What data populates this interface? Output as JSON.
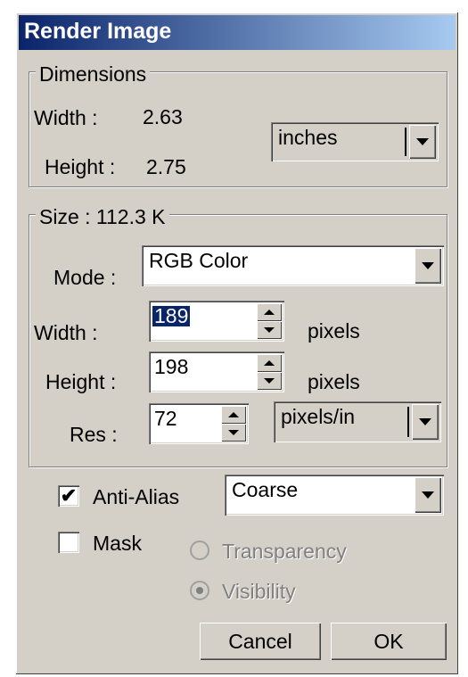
{
  "window": {
    "title": "Render Image"
  },
  "dimensions": {
    "legend": "Dimensions",
    "width_label": "Width :",
    "width_value": "2.63",
    "height_label": "Height :",
    "height_value": "2.75",
    "unit": "inches"
  },
  "size": {
    "legend": "Size : 112.3 K",
    "mode_label": "Mode :",
    "mode_value": "RGB Color",
    "width_label": "Width :",
    "width_value": "189",
    "width_unit": "pixels",
    "height_label": "Height :",
    "height_value": "198",
    "height_unit": "pixels",
    "res_label": "Res :",
    "res_value": "72",
    "res_unit": "pixels/in"
  },
  "options": {
    "anti_alias_label": "Anti-Alias",
    "anti_alias_checked": true,
    "anti_alias_mode": "Coarse",
    "mask_label": "Mask",
    "mask_checked": false,
    "transparency_label": "Transparency",
    "visibility_label": "Visibility"
  },
  "buttons": {
    "cancel": "Cancel",
    "ok": "OK"
  }
}
